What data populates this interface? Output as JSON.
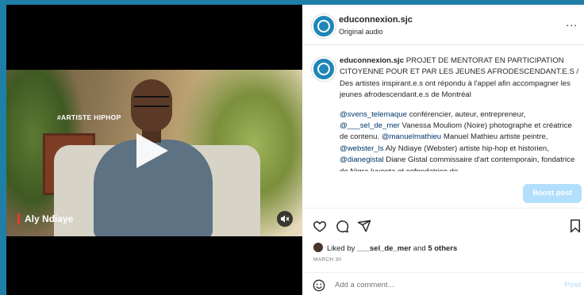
{
  "video": {
    "hashtag": "#ARTISTE HIPHOP",
    "name_tag": "Aly Ndiaye"
  },
  "header": {
    "username": "educonnexion.sjc",
    "audio": "Original audio",
    "more": "..."
  },
  "caption": {
    "username": "educonnexion.sjc",
    "intro": "PROJET DE MENTORAT EN PARTICIPATION CITOYENNE POUR ET PAR LES JEUNES AFRODESCENDANT.E.S / Des artistes inspirant.e.s ont répondu à l'appel afin accompagner les jeunes afrodescendant.e.s de Montréal",
    "m1": "@svens_telemaque",
    "t1": " conférencier, auteur, entrepreneur,",
    "m2": "@___sel_de_mer",
    "t2": " Vanessa Mouliom (Noire) photographe et créatrice de contenu. ",
    "m3": "@manuelmathieu",
    "t3": " Manuel Mathieu artiste peintre, ",
    "m4": "@webster_ls",
    "t4": " Aly Ndiaye (Webster) artiste hip-hop et historien, ",
    "m5": "@dianegistal",
    "t5": " Diane Gistal commissaire d'art contemporain, fondatrice de Nigra Iuventa et cofondatrice de"
  },
  "actions": {
    "boost_label": "Boost post"
  },
  "likes": {
    "prefix": "Liked by ",
    "user": "___sel_de_mer",
    "mid": " and ",
    "others": "5 others"
  },
  "date": "MARCH 30",
  "comment": {
    "placeholder": "Add a comment...",
    "post_label": "Post"
  },
  "colors": {
    "background": "#1f7fa6",
    "avatar": "#1f86b8",
    "boost": "#b2dffc",
    "mention": "#00376b"
  },
  "icons": [
    "heart-icon",
    "comment-icon",
    "share-icon",
    "bookmark-icon",
    "mute-icon",
    "emoji-icon",
    "more-icon"
  ]
}
